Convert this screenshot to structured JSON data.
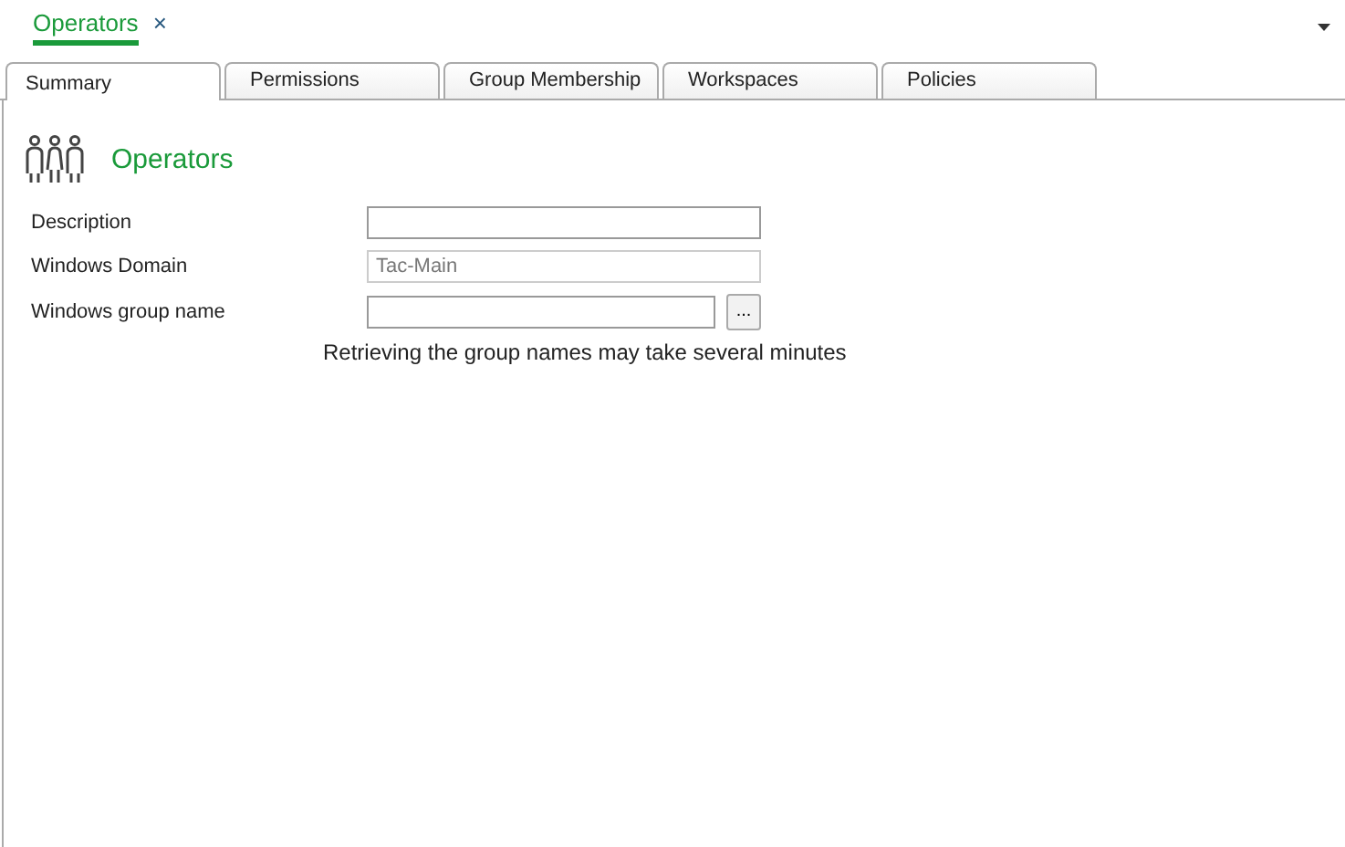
{
  "document_tab": {
    "title": "Operators",
    "close": "×"
  },
  "tabs": [
    {
      "label": "Summary",
      "selected": true
    },
    {
      "label": "Permissions",
      "selected": false
    },
    {
      "label": "Group Membership",
      "selected": false
    },
    {
      "label": "Workspaces",
      "selected": false
    },
    {
      "label": "Policies",
      "selected": false
    }
  ],
  "header": {
    "title": "Operators"
  },
  "fields": [
    {
      "label": "Description",
      "disabled": false,
      "kind": "text"
    },
    {
      "label": "Windows Domain",
      "value": "Tac-Main",
      "disabled": true,
      "kind": "text"
    },
    {
      "label": "Windows group name",
      "disabled": false,
      "kind": "browse",
      "button": "..."
    }
  ],
  "hint": "Retrieving the group names may take several minutes"
}
